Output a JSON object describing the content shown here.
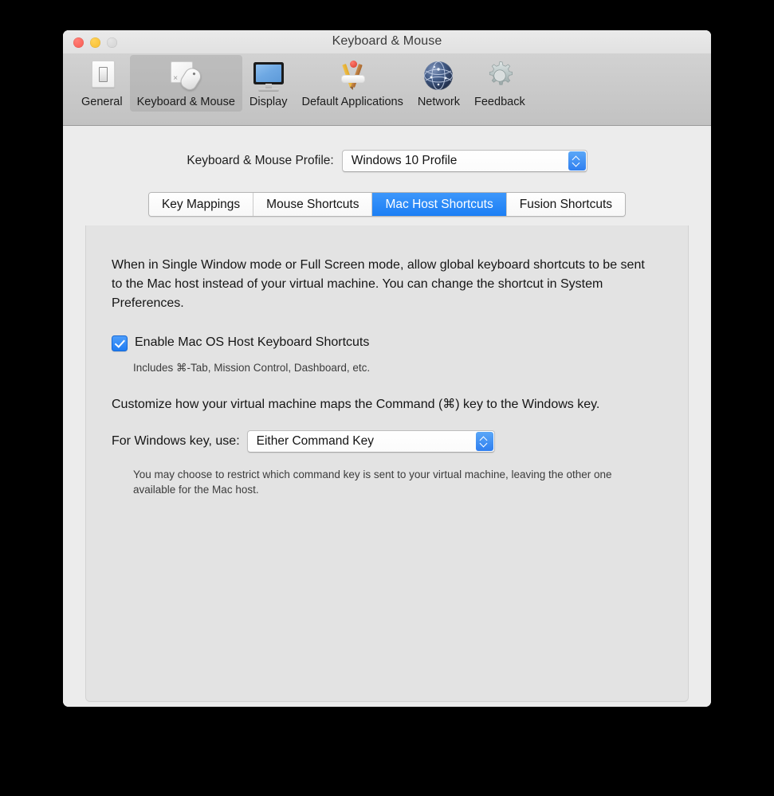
{
  "window": {
    "title": "Keyboard & Mouse",
    "traffic_lights": [
      {
        "name": "close",
        "color": "#f9594f"
      },
      {
        "name": "minimize",
        "color": "#f7bd2e"
      },
      {
        "name": "zoom",
        "color": "#d2d2d2"
      }
    ]
  },
  "toolbar": {
    "items": [
      {
        "label": "General",
        "icon": "light-switch-icon",
        "selected": false
      },
      {
        "label": "Keyboard & Mouse",
        "icon": "keyboard-mouse-icon",
        "selected": true
      },
      {
        "label": "Display",
        "icon": "display-monitor-icon",
        "selected": false
      },
      {
        "label": "Default Applications",
        "icon": "default-applications-icon",
        "selected": false
      },
      {
        "label": "Network",
        "icon": "network-globe-icon",
        "selected": false
      },
      {
        "label": "Feedback",
        "icon": "gear-icon",
        "selected": false
      }
    ]
  },
  "profile": {
    "label": "Keyboard & Mouse Profile:",
    "selected": "Windows 10 Profile"
  },
  "tabs": [
    {
      "label": "Key Mappings",
      "active": false
    },
    {
      "label": "Mouse Shortcuts",
      "active": false
    },
    {
      "label": "Mac Host Shortcuts",
      "active": true
    },
    {
      "label": "Fusion Shortcuts",
      "active": false
    }
  ],
  "content": {
    "intro": "When in Single Window mode or Full Screen mode, allow global keyboard shortcuts to be sent to the Mac host instead of your virtual machine. You can change the shortcut in System Preferences.",
    "enable_checkbox_label": "Enable Mac OS Host Keyboard Shortcuts",
    "enable_checkbox_checked": true,
    "enable_hint": "Includes ⌘-Tab, Mission Control, Dashboard, etc.",
    "customize_text": "Customize how your virtual machine maps the Command (⌘) key to the Windows key.",
    "windows_key_label": "For Windows key, use:",
    "windows_key_selected": "Either Command Key",
    "windows_key_hint": "You may choose to restrict which command key is sent to your virtual machine, leaving the other one available for the Mac host."
  },
  "colors": {
    "accent_blue": "#1b7ef4",
    "panel_bg": "#e3e3e3",
    "window_bg": "#ececec",
    "toolbar_selected": "#c4c4c4"
  }
}
